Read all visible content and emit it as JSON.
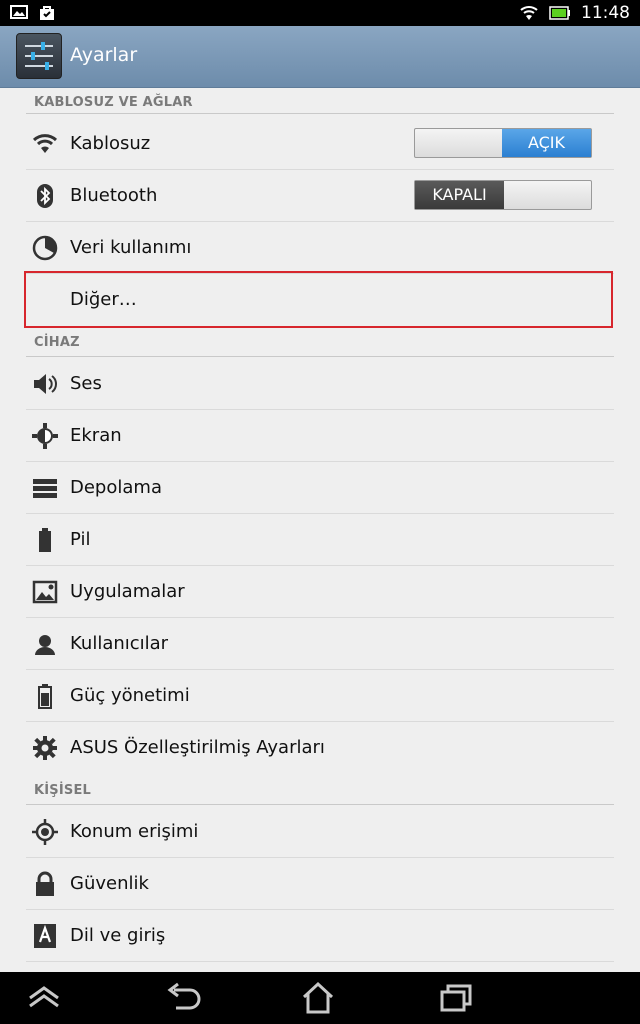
{
  "status_bar": {
    "time": "11:48",
    "left_icons": [
      "gallery-icon",
      "shopping-bag-icon"
    ],
    "right_icons": [
      "wifi-icon",
      "battery-icon"
    ]
  },
  "action_bar": {
    "title": "Ayarlar",
    "icon": "settings-sliders-icon"
  },
  "sections": [
    {
      "header": "KABLOSUZ VE AĞLAR",
      "items": [
        {
          "label": "Kablosuz",
          "icon": "wifi-icon",
          "toggle": "AÇIK"
        },
        {
          "label": "Bluetooth",
          "icon": "bluetooth-icon",
          "toggle": "KAPALI"
        },
        {
          "label": "Veri kullanımı",
          "icon": "data-usage-icon"
        },
        {
          "label": "Diğer…",
          "icon": ""
        }
      ]
    },
    {
      "header": "CİHAZ",
      "items": [
        {
          "label": "Ses",
          "icon": "speaker-icon"
        },
        {
          "label": "Ekran",
          "icon": "brightness-icon"
        },
        {
          "label": "Depolama",
          "icon": "storage-icon"
        },
        {
          "label": "Pil",
          "icon": "battery-icon"
        },
        {
          "label": "Uygulamalar",
          "icon": "apps-icon"
        },
        {
          "label": "Kullanıcılar",
          "icon": "user-icon"
        },
        {
          "label": "Güç yönetimi",
          "icon": "power-battery-icon"
        },
        {
          "label": "ASUS Özelleştirilmiş Ayarları",
          "icon": "gear-icon"
        }
      ]
    },
    {
      "header": "KİŞİSEL",
      "items": [
        {
          "label": "Konum erişimi",
          "icon": "location-icon"
        },
        {
          "label": "Güvenlik",
          "icon": "lock-icon"
        },
        {
          "label": "Dil ve giriş",
          "icon": "keyboard-a-icon"
        }
      ]
    }
  ],
  "nav_bar": {
    "icons": [
      "recent-up-icon",
      "back-icon",
      "home-icon",
      "recent-apps-icon"
    ]
  },
  "colors": {
    "action_bar": "#7b98b6",
    "toggle_on": "#2b7fd1",
    "highlight": "#d7262d",
    "background": "#efefef"
  }
}
